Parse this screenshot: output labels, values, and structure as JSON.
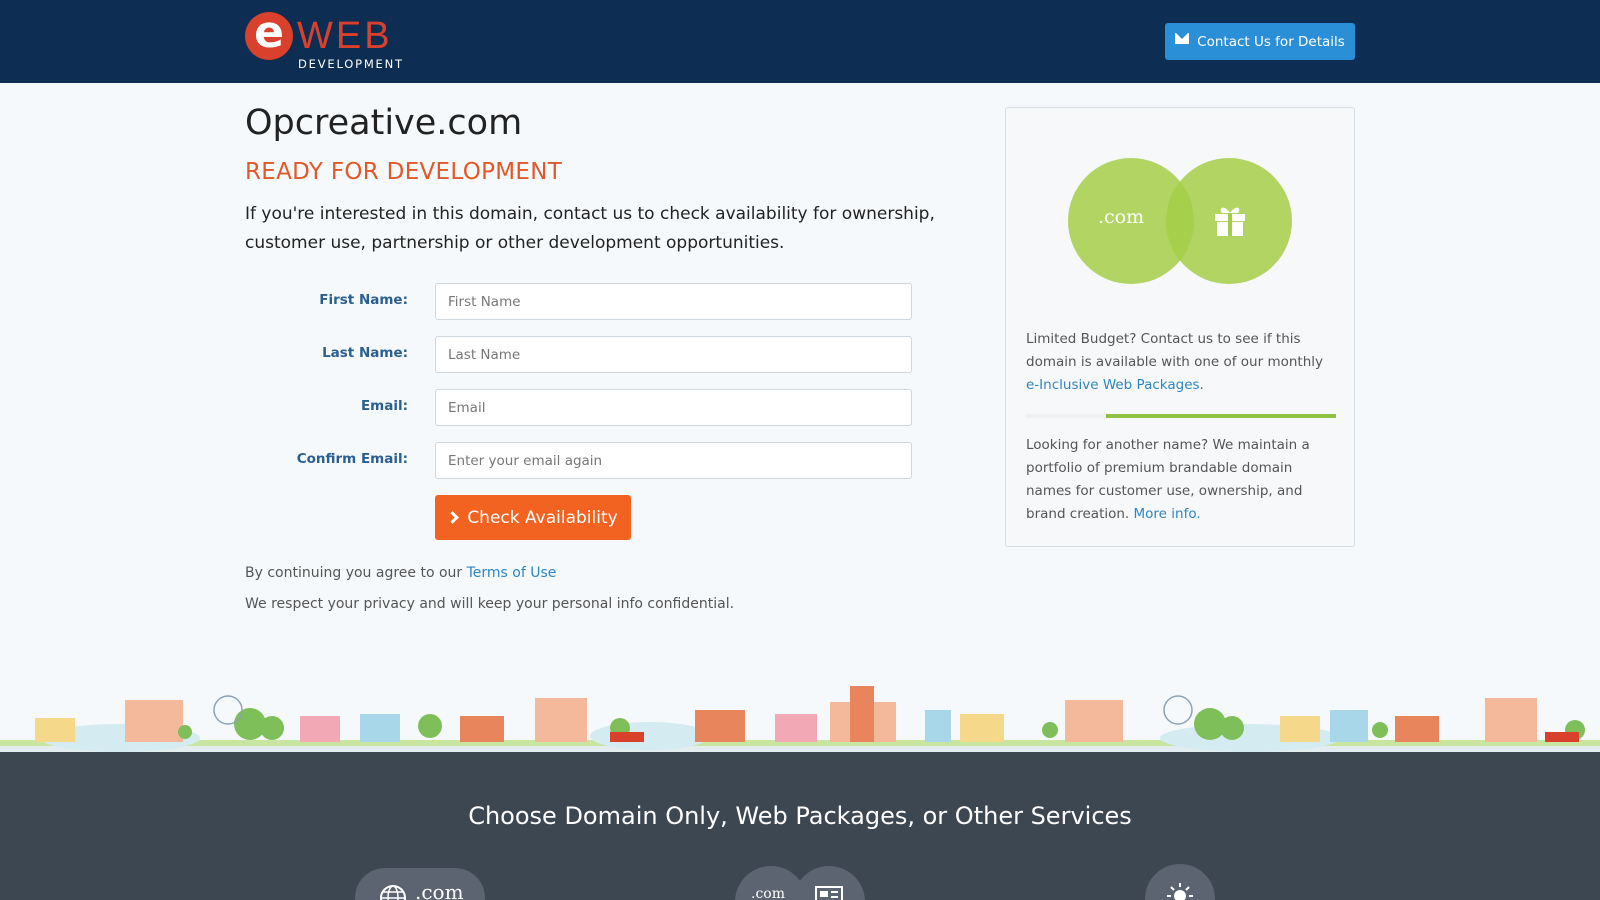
{
  "header": {
    "logo_letter": "e",
    "logo_text": "WEB",
    "logo_subtext": "DEVELOPMENT",
    "contact_button": "Contact Us for Details"
  },
  "main": {
    "domain": "Opcreative.com",
    "status": "READY FOR DEVELOPMENT",
    "intro": "If you're interested in this domain, contact us to check availability for ownership, customer use, partnership or other development opportunities."
  },
  "form": {
    "fields": [
      {
        "label": "First Name:",
        "placeholder": "First Name",
        "value": ""
      },
      {
        "label": "Last Name:",
        "placeholder": "Last Name",
        "value": ""
      },
      {
        "label": "Email:",
        "placeholder": "Email",
        "value": ""
      },
      {
        "label": "Confirm Email:",
        "placeholder": "Enter your email again",
        "value": ""
      }
    ],
    "submit": "Check Availability"
  },
  "legal": {
    "agree_prefix": "By continuing you agree to our ",
    "terms_link": "Terms of Use",
    "privacy": "We respect your privacy and will keep your personal info confidential."
  },
  "sidebar": {
    "badge_text": ".com",
    "budget_text": "Limited Budget? Contact us to see if this domain is available with one of our monthly ",
    "budget_link": "e-Inclusive Web Packages",
    "budget_end": ".",
    "portfolio_text": "Looking for another name? We maintain a portfolio of premium brandable domain names for customer use, ownership, and brand creation. ",
    "portfolio_link": "More info."
  },
  "footer": {
    "title": "Choose Domain Only, Web Packages, or Other Services",
    "svc1_text": ".com",
    "svc2_text": ".com"
  },
  "colors": {
    "header_bg": "#0e2d52",
    "accent_orange": "#f26220",
    "accent_blue": "#2b8fd8",
    "accent_green": "#8fc243",
    "footer_bg": "#3d4752"
  }
}
